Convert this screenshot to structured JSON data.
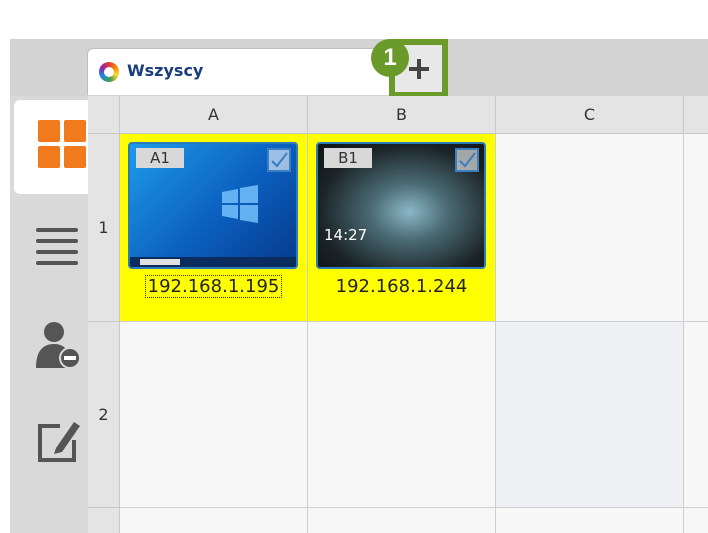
{
  "tabs": [
    {
      "label": "Wszyscy",
      "active": true
    }
  ],
  "callout_number": "1",
  "columns": [
    "A",
    "B",
    "C"
  ],
  "rows": [
    "1",
    "2"
  ],
  "devices": [
    {
      "cell": "A1",
      "label": "A1",
      "ip": "192.168.1.195",
      "selected": true,
      "focused": true
    },
    {
      "cell": "B1",
      "label": "B1",
      "ip": "192.168.1.244",
      "selected": true,
      "focused": false,
      "lockscreen_time": "14:27"
    }
  ],
  "sidebar": [
    {
      "icon": "grid-view-icon",
      "active": true
    },
    {
      "icon": "list-view-icon",
      "active": false
    },
    {
      "icon": "user-remove-icon",
      "active": false
    },
    {
      "icon": "edit-icon",
      "active": false
    }
  ],
  "colors": {
    "accent_green": "#6a9a2a",
    "highlight_yellow": "#ffff00",
    "grid_orange": "#f07a1c"
  }
}
